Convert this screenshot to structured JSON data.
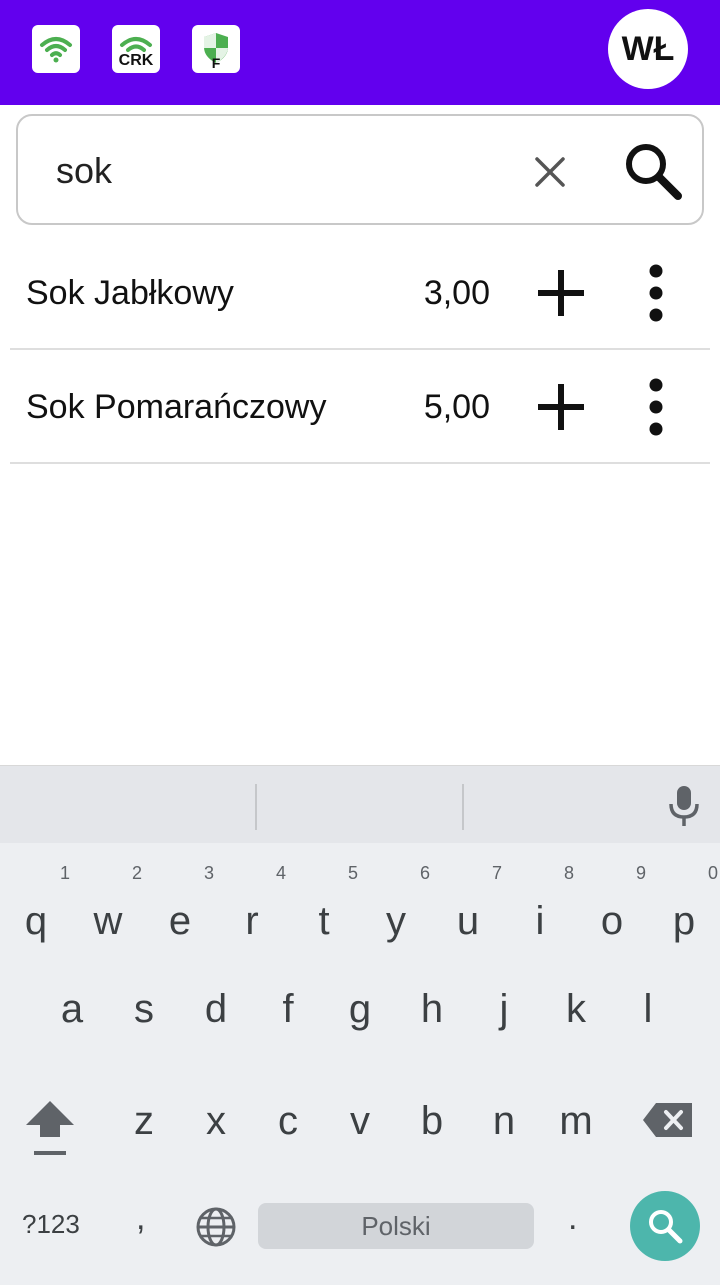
{
  "header": {
    "status_icons": [
      {
        "name": "wifi-icon",
        "label": ""
      },
      {
        "name": "crk-wifi-icon",
        "label": "CRK"
      },
      {
        "name": "shield-f-icon",
        "label": "F"
      }
    ],
    "user_initials": "WŁ",
    "colors": {
      "bar": "#6200ee",
      "icon_green": "#4caf50"
    }
  },
  "search": {
    "value": "sok",
    "clear_icon": "close-icon",
    "search_icon": "search-icon"
  },
  "products": [
    {
      "name": "Sok Jabłkowy",
      "price": "3,00"
    },
    {
      "name": "Sok Pomarańczowy",
      "price": "5,00"
    }
  ],
  "keyboard": {
    "row1": [
      {
        "key": "q",
        "hint": "1"
      },
      {
        "key": "w",
        "hint": "2"
      },
      {
        "key": "e",
        "hint": "3"
      },
      {
        "key": "r",
        "hint": "4"
      },
      {
        "key": "t",
        "hint": "5"
      },
      {
        "key": "y",
        "hint": "6"
      },
      {
        "key": "u",
        "hint": "7"
      },
      {
        "key": "i",
        "hint": "8"
      },
      {
        "key": "o",
        "hint": "9"
      },
      {
        "key": "p",
        "hint": "0"
      }
    ],
    "row2": [
      "a",
      "s",
      "d",
      "f",
      "g",
      "h",
      "j",
      "k",
      "l"
    ],
    "row3": [
      "z",
      "x",
      "c",
      "v",
      "b",
      "n",
      "m"
    ],
    "symbols_label": "?123",
    "comma": ",",
    "space_label": "Polski",
    "period": ".",
    "go_color": "#4db6ac"
  }
}
